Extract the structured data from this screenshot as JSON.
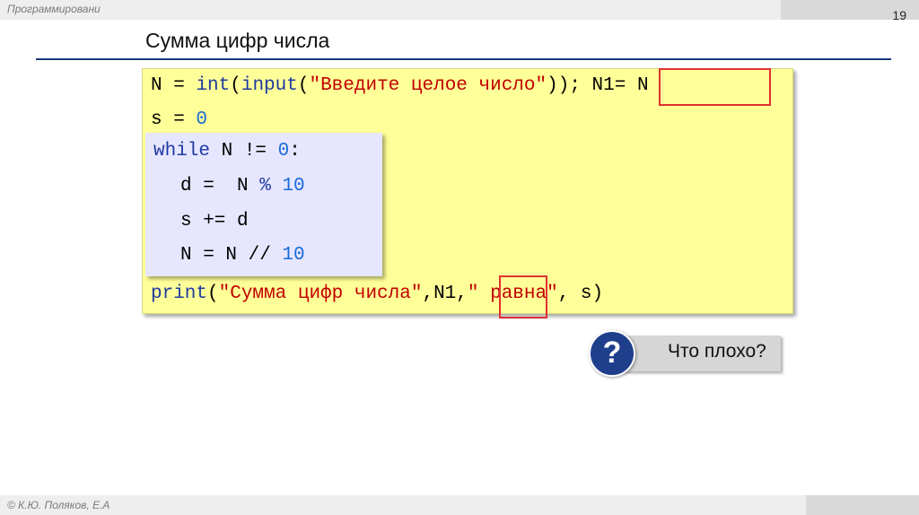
{
  "header": {
    "course_label": "Программировани",
    "page_number": "19"
  },
  "slide": {
    "title": "Сумма цифр числа"
  },
  "code": {
    "line1": {
      "var": "N",
      "eq": " = ",
      "fn1": "int",
      "p1": "(",
      "fn2": "input",
      "p2": "(",
      "str": "\"Введите целое число\"",
      "p3": "))",
      "highlight": "; N1= N"
    },
    "line2": {
      "var": "s",
      "eq": " = ",
      "num": "0"
    },
    "loop": {
      "line1": {
        "kw": "while",
        "cond": " N != ",
        "num": "0",
        "colon": ":"
      },
      "line2": {
        "text": "d =  N ",
        "op": "%",
        "sp": " ",
        "num": "10"
      },
      "line3": {
        "text": "s += d"
      },
      "line4": {
        "text": "N = N // ",
        "num": "10"
      }
    },
    "print_line": {
      "kw": "print",
      "p1": "(",
      "str1": "\"Сумма цифр числа\"",
      "comma1": ",",
      "highlight": "N1,",
      "str2": "\" равна\"",
      "tail": ", s)"
    }
  },
  "callout": {
    "icon": "question-icon",
    "symbol": "?",
    "text": "Что плохо?"
  },
  "footer": {
    "author": "© К.Ю. Поляков, Е.А"
  },
  "colors": {
    "keyword": "#1f3aa0",
    "number": "#1a6ad6",
    "string": "#c00000",
    "code_bg": "#ffff99",
    "loop_bg": "#e6e6ff",
    "title_rule": "#1b3a7a",
    "highlight_frame": "#e03030"
  }
}
